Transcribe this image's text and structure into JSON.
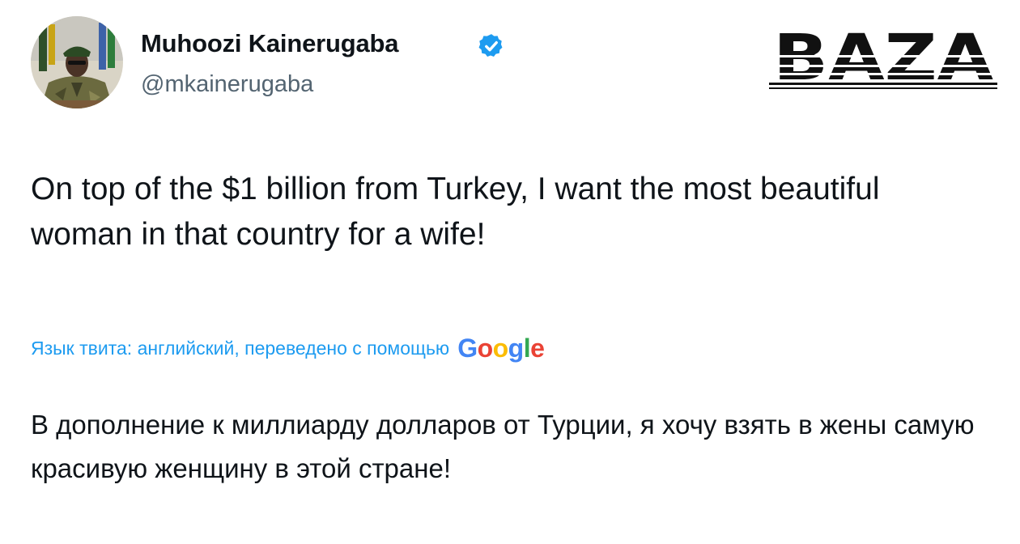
{
  "author": {
    "display_name": "Muhoozi Kainerugaba",
    "handle": "@mkainerugaba",
    "verified": true,
    "avatar_icon": "military-officer-avatar"
  },
  "watermark": {
    "logo_text": "BAZA",
    "icon": "baza-logo"
  },
  "tweet": {
    "text": "On top of the $1 billion from Turkey, I want the most beautiful woman in that country for a wife!"
  },
  "translation": {
    "label": "Язык твита: английский, переведено с помощью",
    "provider_letters": [
      "G",
      "o",
      "o",
      "g",
      "l",
      "e"
    ],
    "provider_colors": [
      "#4285F4",
      "#EA4335",
      "#FBBC05",
      "#4285F4",
      "#34A853",
      "#EA4335"
    ],
    "text": "В дополнение к миллиарду долларов от Турции, я хочу взять в жены самую красивую женщину в этой стране!"
  },
  "colors": {
    "text": "#0f1419",
    "secondary": "#536471",
    "link": "#1d9bf0",
    "verified": "#1d9bf0"
  }
}
